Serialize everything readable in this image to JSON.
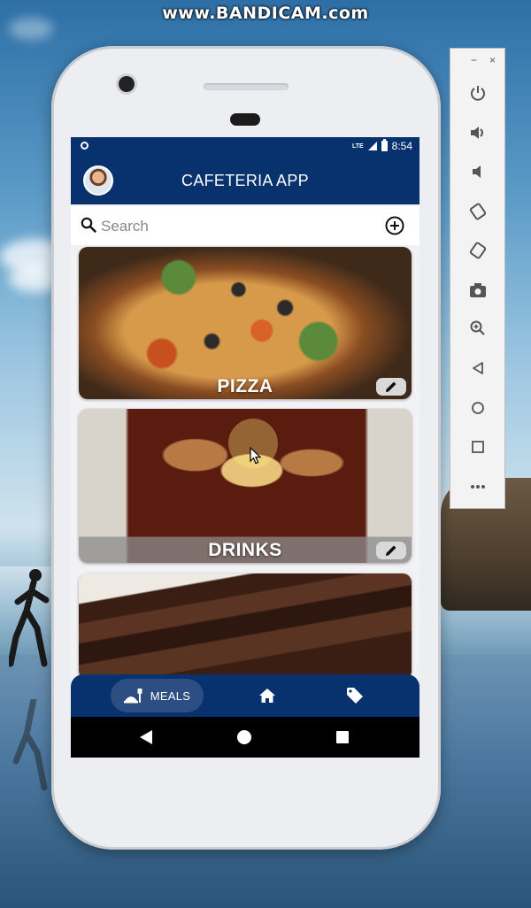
{
  "watermark": "www.BANDICAM.com",
  "status_bar": {
    "network": "LTE",
    "time": "8:54"
  },
  "app_bar": {
    "title": "CAFETERIA APP"
  },
  "search": {
    "placeholder": "Search",
    "value": ""
  },
  "categories": [
    {
      "label": "PIZZA"
    },
    {
      "label": "DRINKS"
    },
    {
      "label": ""
    }
  ],
  "bottom_nav": {
    "items": [
      {
        "label": "MEALS",
        "icon": "meals-icon",
        "active": true
      },
      {
        "label": "",
        "icon": "home-icon",
        "active": false
      },
      {
        "label": "",
        "icon": "tag-icon",
        "active": false
      }
    ]
  },
  "emulator_toolbar": {
    "window_controls": [
      "−",
      "×"
    ],
    "buttons": [
      "power-icon",
      "volume-up-icon",
      "volume-down-icon",
      "rotate-left-icon",
      "rotate-right-icon",
      "camera-icon",
      "zoom-icon",
      "back-icon",
      "home-icon",
      "overview-icon",
      "more-icon"
    ]
  },
  "colors": {
    "primary": "#07326e",
    "nav_active": "#2d4e82",
    "edit_button": "#d9d9d9"
  }
}
